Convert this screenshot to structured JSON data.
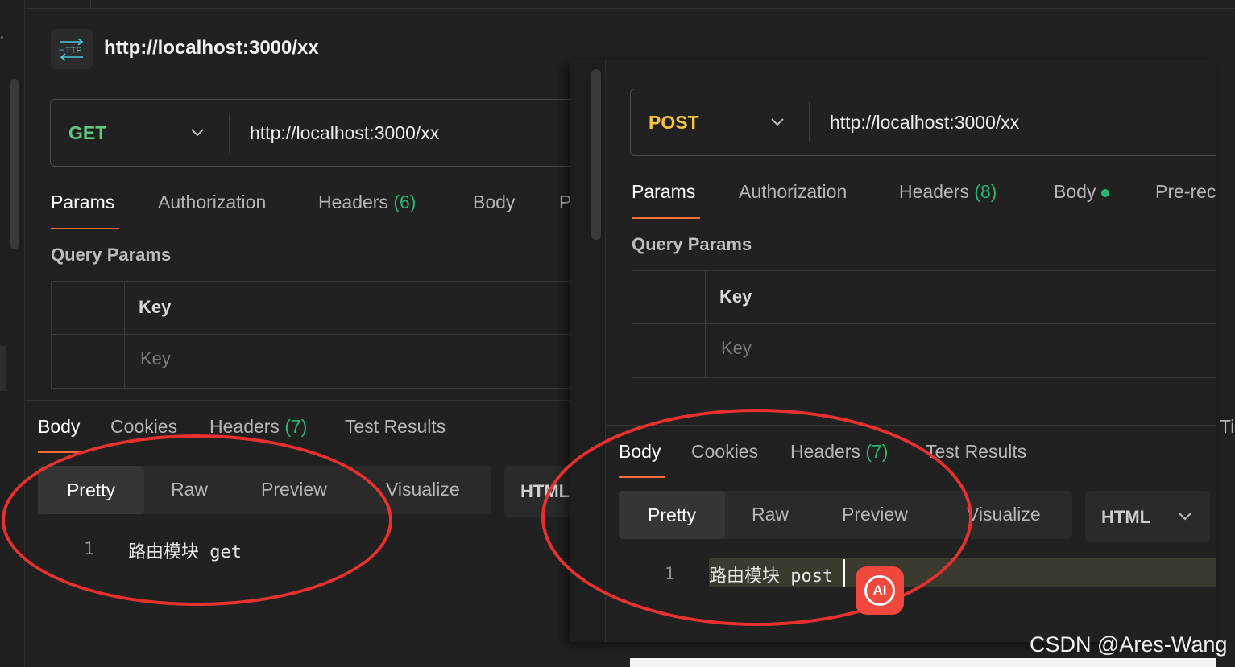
{
  "request_title": "http://localhost:3000/xx",
  "left": {
    "method": "GET",
    "method_color": "#5fc97e",
    "url": "http://localhost:3000/xx",
    "tabs": [
      {
        "label": "Params",
        "count": ""
      },
      {
        "label": "Authorization",
        "count": ""
      },
      {
        "label": "Headers",
        "count": "(6)"
      },
      {
        "label": "Body",
        "count": ""
      },
      {
        "label": "P",
        "count": ""
      }
    ],
    "query_title": "Query Params",
    "key_header": "Key",
    "key_placeholder": "Key",
    "response_tabs": [
      {
        "label": "Body",
        "count": ""
      },
      {
        "label": "Cookies",
        "count": ""
      },
      {
        "label": "Headers",
        "count": "(7)"
      },
      {
        "label": "Test Results",
        "count": ""
      }
    ],
    "views": [
      "Pretty",
      "Raw",
      "Preview",
      "Visualize"
    ],
    "format": "HTML",
    "code_line_no": "1",
    "code_text": "路由模块 get"
  },
  "right": {
    "method": "POST",
    "method_color": "#f4c542",
    "url": "http://localhost:3000/xx",
    "tabs": [
      {
        "label": "Params",
        "count": ""
      },
      {
        "label": "Authorization",
        "count": ""
      },
      {
        "label": "Headers",
        "count": "(8)"
      },
      {
        "label": "Body",
        "count": ""
      },
      {
        "label": "Pre-rec",
        "count": ""
      }
    ],
    "query_title": "Query Params",
    "key_header": "Key",
    "key_placeholder": "Key",
    "response_tabs": [
      {
        "label": "Body",
        "count": ""
      },
      {
        "label": "Cookies",
        "count": ""
      },
      {
        "label": "Headers",
        "count": "(7)"
      },
      {
        "label": "Test Results",
        "count": ""
      }
    ],
    "views": [
      "Pretty",
      "Raw",
      "Preview",
      "Visualize"
    ],
    "format": "HTML",
    "code_line_no": "1",
    "code_text": "路由模块 post",
    "edge_label": "Ti"
  },
  "ai_badge": "AI",
  "watermark": "CSDN @Ares-Wang",
  "colors": {
    "accent": "#ff6c37",
    "count_green": "#2bb673",
    "annotation_red": "#e8312f"
  },
  "icons": [
    "http-icon",
    "chevron-down-icon",
    "ai-icon"
  ]
}
